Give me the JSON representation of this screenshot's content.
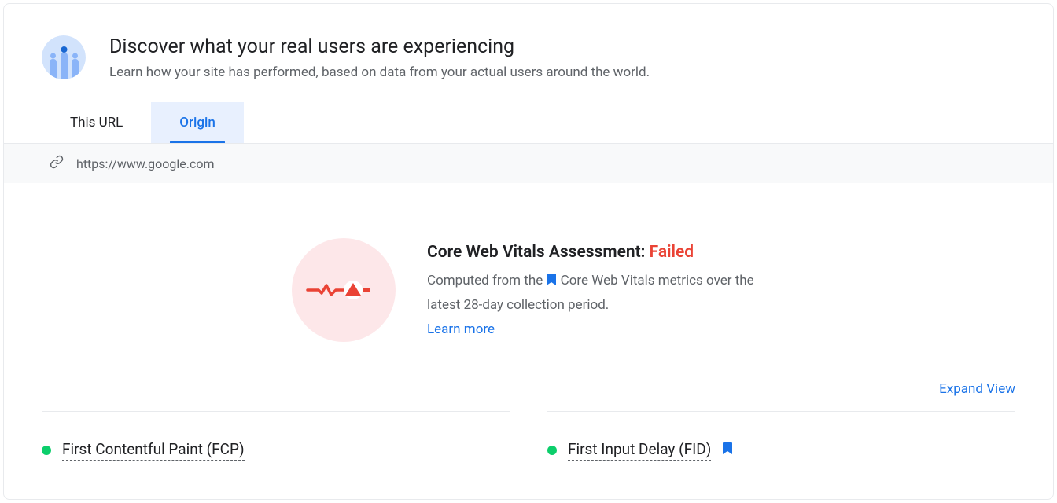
{
  "header": {
    "title": "Discover what your real users are experiencing",
    "subtitle": "Learn how your site has performed, based on data from your actual users around the world."
  },
  "tabs": {
    "this_url": "This URL",
    "origin": "Origin"
  },
  "url_bar": {
    "url": "https://www.google.com"
  },
  "assessment": {
    "title_prefix": "Core Web Vitals Assessment: ",
    "status": "Failed",
    "desc_part1": "Computed from the ",
    "desc_part2": " Core Web Vitals metrics over the latest 28-day collection period.",
    "learn_more": "Learn more"
  },
  "expand_view": "Expand View",
  "metrics": {
    "fcp": {
      "name": "First Contentful Paint (FCP)",
      "status": "good"
    },
    "fid": {
      "name": "First Input Delay (FID)",
      "status": "good",
      "bookmarked": true
    }
  }
}
